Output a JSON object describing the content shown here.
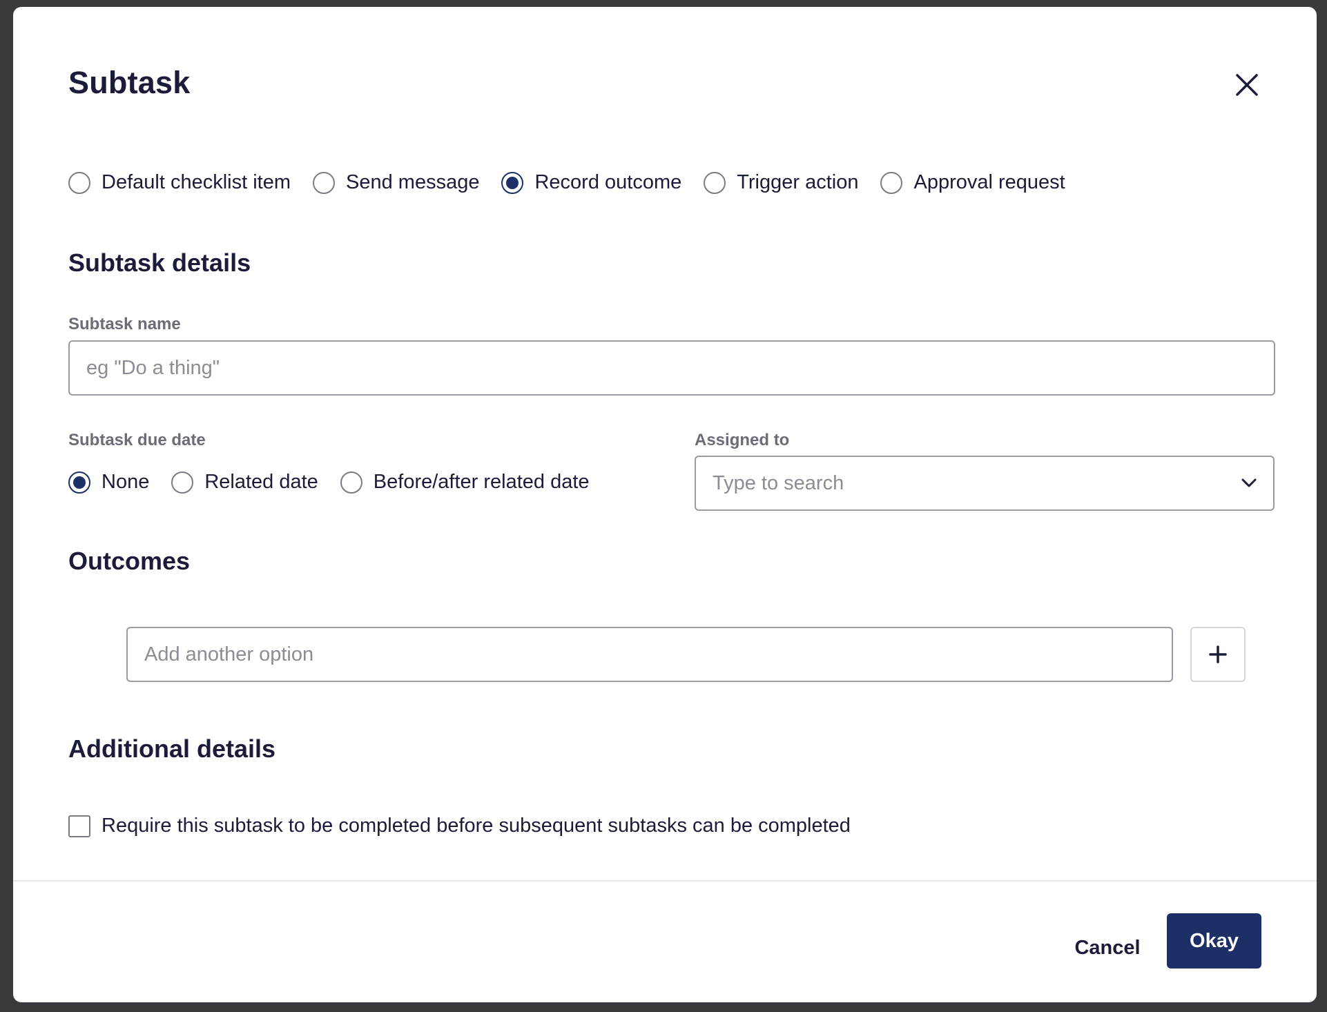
{
  "modal": {
    "title": "Subtask"
  },
  "subtask_types": [
    {
      "label": "Default checklist item",
      "checked": false
    },
    {
      "label": "Send message",
      "checked": false
    },
    {
      "label": "Record outcome",
      "checked": true
    },
    {
      "label": "Trigger action",
      "checked": false
    },
    {
      "label": "Approval request",
      "checked": false
    }
  ],
  "details": {
    "section_title": "Subtask details",
    "name_label": "Subtask name",
    "name_placeholder": "eg \"Do a thing\"",
    "name_value": "",
    "due_label": "Subtask due date",
    "due_options": [
      {
        "label": "None",
        "checked": true
      },
      {
        "label": "Related date",
        "checked": false
      },
      {
        "label": "Before/after related date",
        "checked": false
      }
    ],
    "assigned_label": "Assigned to",
    "assigned_placeholder": "Type to search"
  },
  "outcomes": {
    "section_title": "Outcomes",
    "option_placeholder": "Add another option"
  },
  "additional": {
    "section_title": "Additional details",
    "require_label": "Require this subtask to be completed before subsequent subtasks can be completed",
    "require_checked": false
  },
  "footer": {
    "cancel_label": "Cancel",
    "okay_label": "Okay"
  },
  "colors": {
    "primary": "#1c2f66",
    "text": "#1b1b3a",
    "muted": "#6c6c78"
  },
  "icons": {
    "close": "close-icon",
    "chevron": "chevron-down-icon",
    "plus": "plus-icon"
  }
}
